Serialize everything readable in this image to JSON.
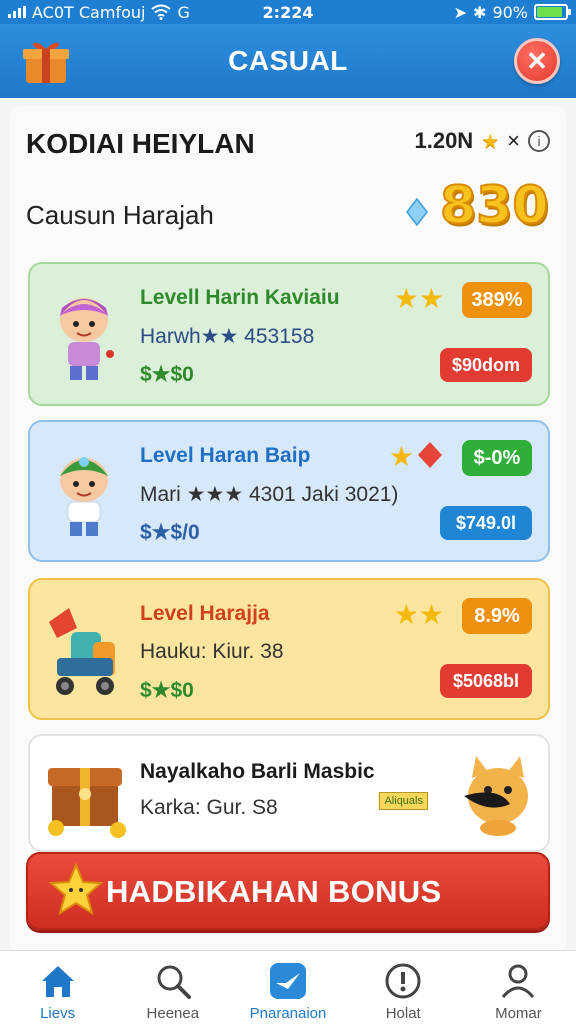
{
  "status_bar": {
    "carrier": "AC0T Camfouj",
    "time": "2:224",
    "battery": "90%",
    "battery_level": 0.9
  },
  "header": {
    "title": "CASUAL"
  },
  "profile": {
    "name": "KODIAI HEIYLAN",
    "stat_value": "1.20N",
    "stat_multiplier": "×",
    "subtitle": "Causun Harajah",
    "score": "830"
  },
  "levels": [
    {
      "title": "Levell Harin Kaviaiu",
      "sub": "Harwh★★ 453158",
      "price": "$★$0",
      "stars": "★★",
      "percent": "389%",
      "price_badge": "$90dom",
      "colors": {
        "title": "#2e8a2a",
        "pct": "#f0900f",
        "badge": "#e23b32"
      }
    },
    {
      "title": "Level Haran Baip",
      "sub": "Mari ★★★ 4301 Jaki 3021)",
      "price": "$★$/0",
      "stars": "★",
      "percent": "$-0%",
      "price_badge": "$749.0l",
      "colors": {
        "title": "#1f6fc4",
        "pct": "#2fae3a",
        "badge": "#1f86d6"
      }
    },
    {
      "title": "Level Harajja",
      "sub": "Hauku: Kiur. 38",
      "price": "$★$0",
      "stars": "★★",
      "percent": "8.9%",
      "price_badge": "$5068bl",
      "colors": {
        "title": "#d1421c",
        "pct": "#f0900f",
        "badge": "#e23b32"
      }
    },
    {
      "title": "Nayalkaho Barli Masbic",
      "sub": "Karka: Gur. S8",
      "badge_small": "Aliquals"
    }
  ],
  "bonus": {
    "label": "HADBIKAHAN BONUS"
  },
  "nav": [
    {
      "label": "Lievs",
      "icon": "home-icon",
      "active": true
    },
    {
      "label": "Heenea",
      "icon": "search-icon",
      "active": false
    },
    {
      "label": "Pnaranaion",
      "icon": "plane-icon",
      "active": true
    },
    {
      "label": "Holat",
      "icon": "info-icon",
      "active": false
    },
    {
      "label": "Momar",
      "icon": "user-icon",
      "active": false
    }
  ]
}
